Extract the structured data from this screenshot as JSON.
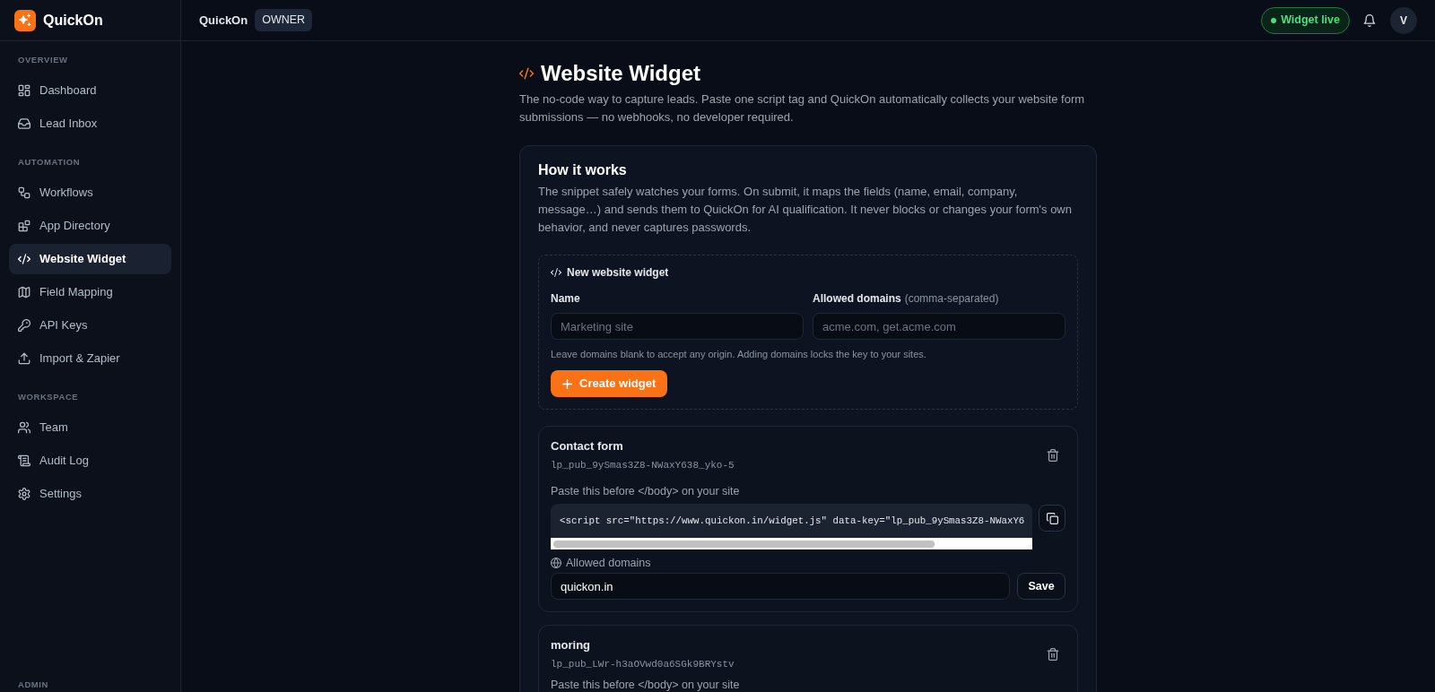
{
  "sidebar": {
    "brand": "QuickOn",
    "sections": [
      {
        "label": "OVERVIEW",
        "items": [
          {
            "label": "Dashboard",
            "selected": false
          },
          {
            "label": "Lead Inbox",
            "selected": false
          }
        ]
      },
      {
        "label": "AUTOMATION",
        "items": [
          {
            "label": "Workflows",
            "selected": false
          },
          {
            "label": "App Directory",
            "selected": false
          },
          {
            "label": "Website Widget",
            "selected": true
          },
          {
            "label": "Field Mapping",
            "selected": false
          },
          {
            "label": "API Keys",
            "selected": false
          },
          {
            "label": "Import & Zapier",
            "selected": false
          }
        ]
      },
      {
        "label": "WORKSPACE",
        "items": [
          {
            "label": "Team",
            "selected": false
          },
          {
            "label": "Audit Log",
            "selected": false
          },
          {
            "label": "Settings",
            "selected": false
          }
        ]
      },
      {
        "label": "ADMIN"
      }
    ]
  },
  "topbar": {
    "workspace": "QuickOn",
    "role": "OWNER",
    "status": "Widget live",
    "avatar": "V"
  },
  "page": {
    "title": "Website Widget",
    "description": "The no-code way to capture leads. Paste one script tag and QuickOn automatically collects your website form submissions — no webhooks, no developer required."
  },
  "how_it_works": {
    "title": "How it works",
    "text": "The snippet safely watches your forms. On submit, it maps the fields (name, email, company, message…) and sends them to QuickOn for AI qualification. It never blocks or changes your form's own behavior, and never captures passwords."
  },
  "new_widget": {
    "title": "New website widget",
    "name_label": "Name",
    "name_placeholder": "Marketing site",
    "domains_label": "Allowed domains",
    "domains_hint": "(comma-separated)",
    "domains_placeholder": "acme.com, get.acme.com",
    "help": "Leave domains blank to accept any origin. Adding domains locks the key to your sites.",
    "button": "Create widget"
  },
  "widgets": [
    {
      "name": "Contact form",
      "key": "lp_pub_9ySmas3Z8-NWaxY638_yko-5",
      "snippet_label": "Paste this before </body> on your site",
      "snippet": "<script src=\"https://www.quickon.in/widget.js\" data-key=\"lp_pub_9ySmas3Z8-NWaxY6",
      "domains_label": "Allowed domains",
      "domains": "quickon.in",
      "save": "Save"
    },
    {
      "name": "moring",
      "key": "lp_pub_LWr-h3aOVwd0a6SGk9BRYstv",
      "snippet_label": "Paste this before </body> on your site"
    }
  ]
}
